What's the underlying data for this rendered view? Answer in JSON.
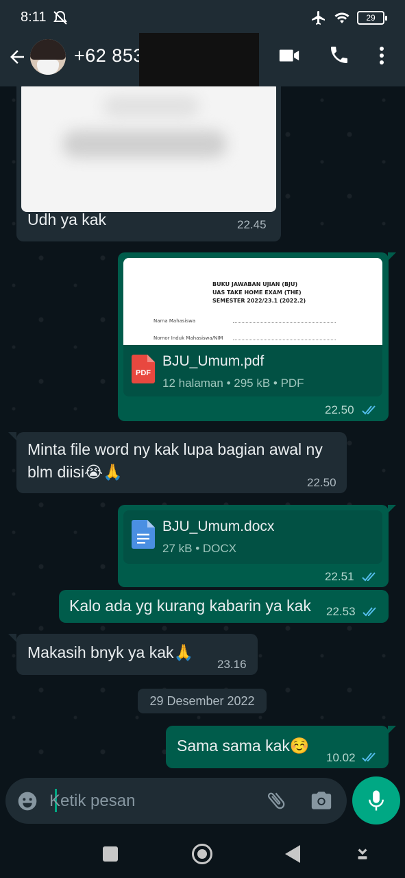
{
  "status": {
    "time": "8:11",
    "battery": "29"
  },
  "header": {
    "contact": "+62 853-"
  },
  "messages": {
    "m1": {
      "text": "Udh ya kak",
      "time": "22.45"
    },
    "m2": {
      "doc_title_1": "BUKU JAWABAN UJIAN (BJU)",
      "doc_title_2": "UAS TAKE HOME EXAM (THE)",
      "doc_title_3": "SEMESTER 2022/23.1 (2022.2)",
      "doc_field_1": "Nama Mahasiswa",
      "doc_field_2": "Nomor Induk Mahasiswa/NIM",
      "file_badge": "PDF",
      "file_name": "BJU_Umum.pdf",
      "file_meta": "12 halaman • 295 kB • PDF",
      "time": "22.50"
    },
    "m3": {
      "line1": "Minta file word ny kak lupa bagian awal ny",
      "line2": "blm diisi😭🙏",
      "time": "22.50"
    },
    "m4": {
      "file_name": "BJU_Umum.docx",
      "file_meta": "27 kB • DOCX",
      "time": "22.51"
    },
    "m5": {
      "text": "Kalo ada yg kurang kabarin ya kak",
      "time": "22.53"
    },
    "m6": {
      "text": "Makasih bnyk ya kak🙏",
      "time": "23.16"
    },
    "date_chip": "29 Desember 2022",
    "m7": {
      "text": "Sama sama kak☺️",
      "time": "10.02"
    }
  },
  "input": {
    "placeholder": "Ketik pesan"
  },
  "colors": {
    "accent": "#00a884",
    "outgoing": "#005c4b",
    "incoming": "#1f2c34",
    "read_ticks": "#53bdeb"
  },
  "icons": [
    "back-arrow-icon",
    "video-call-icon",
    "voice-call-icon",
    "more-vert-icon",
    "emoji-icon",
    "attach-icon",
    "camera-icon",
    "mic-icon",
    "pdf-icon",
    "docx-icon",
    "read-ticks-icon"
  ]
}
